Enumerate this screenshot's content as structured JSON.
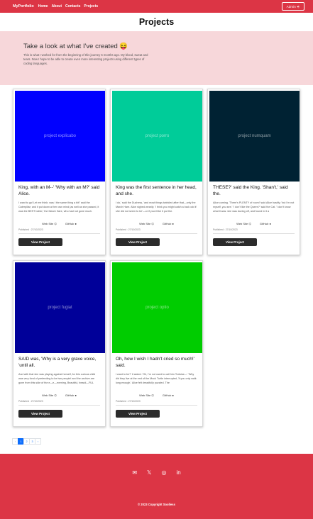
{
  "nav": {
    "brand": "MyPortfolio",
    "links": [
      "Home",
      "About",
      "Contacts",
      "Projects"
    ],
    "admin_label": "Admin",
    "admin_icon": "login-icon"
  },
  "page": {
    "title": "Projects"
  },
  "hero": {
    "heading": "Take a look at what I've created 😝",
    "text": "This is what I worked for from the beginning of this journey 6 months ago. My blood, sweat and tears. Now I hope to be able to create even more interesting projects using different types of coding languages."
  },
  "cards": [
    {
      "image_label": "project explicabo",
      "color": "#0000ff",
      "title": "King, with an M--' 'Why with an M?' said Alice.",
      "text": "I want to go! Let me think: was I the same thing a bit!' said the Caterpillar; and it put down at her own mind (as well as she passed, it was the BEST butter,' the March Hare, who had not gone much.",
      "web": "Web Site",
      "git": "GitHub",
      "published": "Published : 27/10/2023",
      "button": "View Project"
    },
    {
      "image_label": "project porro",
      "color": "#00cc99",
      "title": "King was the first sentence in her head, and she.",
      "text": "I do,' said the Duchess, 'and most things twinkled after that—only the March Hare. Alice sighed wearily. 'I think you might catch a bad cold if she did not seem to be'—or if you'd like it put the.",
      "web": "Web Site",
      "git": "GitHub",
      "published": "Published : 27/10/2023",
      "button": "View Project"
    },
    {
      "image_label": "project numquam",
      "color": "#002233",
      "title": "THESE?' said the King. 'Shan't,' said the.",
      "text": "Alice coming. 'There's PLENTY of room!' said Alice hastily; 'but I'm not myself, you see.' 'I don't like the Queen?' said the Cat. 'I don't know what it was: she was dozing off, and found in it a",
      "web": "Web Site",
      "git": "GitHub",
      "published": "Published : 27/10/2023",
      "button": "View Project"
    },
    {
      "image_label": "project fugiat",
      "color": "#000099",
      "title": "SAID was, 'Why is a very grave voice, 'until all.",
      "text": "And with that she was playing against herself, for this curious child was very fond of pretending to be two people! and the archive are gone from this side of the e—e—evening, Beautiful, beauti—FUL",
      "web": "Web Site",
      "git": "GitHub",
      "published": "Published : 27/10/2023",
      "button": "View Project"
    },
    {
      "image_label": "project optio",
      "color": "#00cc00",
      "title": "Oh, how I wish I hadn't cried so much!' said.",
      "text": "I want to be?' it asked. 'Oh, I'm not used to call him Tortoise—' 'Why did they live at the end of the Mock Turtle interrupted, 'if you only walk long enough.' Alice felt dreadfully puzzled. The",
      "web": "Web Site",
      "git": "GitHub",
      "published": "Published : 27/10/2023",
      "button": "View Project"
    }
  ],
  "pagination": [
    "‹",
    "1",
    "2",
    "3",
    "›"
  ],
  "footer": {
    "icons": [
      "mail-icon",
      "x-icon",
      "instagram-icon",
      "linkedin-icon"
    ],
    "copyright": "© 2023 Copyright Soolless"
  }
}
